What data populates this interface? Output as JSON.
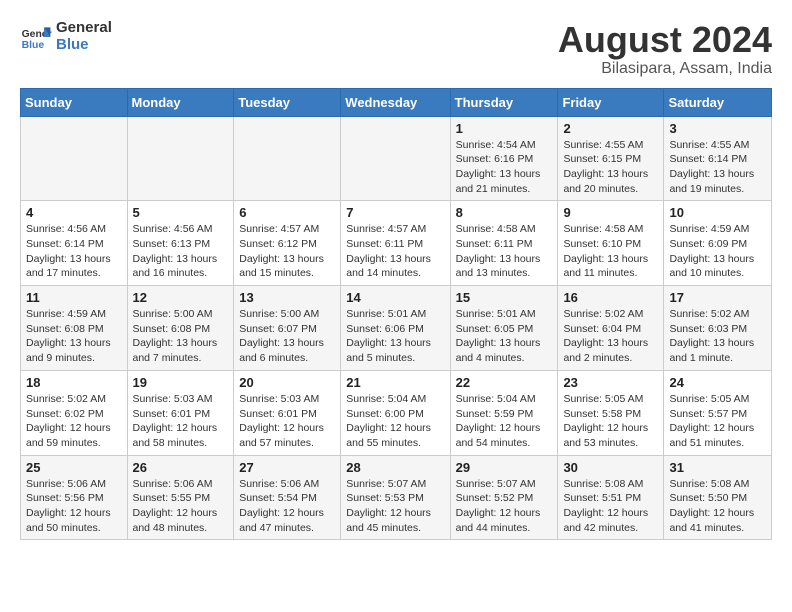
{
  "header": {
    "logo_line1": "General",
    "logo_line2": "Blue",
    "month_year": "August 2024",
    "location": "Bilasipara, Assam, India"
  },
  "weekdays": [
    "Sunday",
    "Monday",
    "Tuesday",
    "Wednesday",
    "Thursday",
    "Friday",
    "Saturday"
  ],
  "weeks": [
    [
      {
        "day": "",
        "info": ""
      },
      {
        "day": "",
        "info": ""
      },
      {
        "day": "",
        "info": ""
      },
      {
        "day": "",
        "info": ""
      },
      {
        "day": "1",
        "info": "Sunrise: 4:54 AM\nSunset: 6:16 PM\nDaylight: 13 hours\nand 21 minutes."
      },
      {
        "day": "2",
        "info": "Sunrise: 4:55 AM\nSunset: 6:15 PM\nDaylight: 13 hours\nand 20 minutes."
      },
      {
        "day": "3",
        "info": "Sunrise: 4:55 AM\nSunset: 6:14 PM\nDaylight: 13 hours\nand 19 minutes."
      }
    ],
    [
      {
        "day": "4",
        "info": "Sunrise: 4:56 AM\nSunset: 6:14 PM\nDaylight: 13 hours\nand 17 minutes."
      },
      {
        "day": "5",
        "info": "Sunrise: 4:56 AM\nSunset: 6:13 PM\nDaylight: 13 hours\nand 16 minutes."
      },
      {
        "day": "6",
        "info": "Sunrise: 4:57 AM\nSunset: 6:12 PM\nDaylight: 13 hours\nand 15 minutes."
      },
      {
        "day": "7",
        "info": "Sunrise: 4:57 AM\nSunset: 6:11 PM\nDaylight: 13 hours\nand 14 minutes."
      },
      {
        "day": "8",
        "info": "Sunrise: 4:58 AM\nSunset: 6:11 PM\nDaylight: 13 hours\nand 13 minutes."
      },
      {
        "day": "9",
        "info": "Sunrise: 4:58 AM\nSunset: 6:10 PM\nDaylight: 13 hours\nand 11 minutes."
      },
      {
        "day": "10",
        "info": "Sunrise: 4:59 AM\nSunset: 6:09 PM\nDaylight: 13 hours\nand 10 minutes."
      }
    ],
    [
      {
        "day": "11",
        "info": "Sunrise: 4:59 AM\nSunset: 6:08 PM\nDaylight: 13 hours\nand 9 minutes."
      },
      {
        "day": "12",
        "info": "Sunrise: 5:00 AM\nSunset: 6:08 PM\nDaylight: 13 hours\nand 7 minutes."
      },
      {
        "day": "13",
        "info": "Sunrise: 5:00 AM\nSunset: 6:07 PM\nDaylight: 13 hours\nand 6 minutes."
      },
      {
        "day": "14",
        "info": "Sunrise: 5:01 AM\nSunset: 6:06 PM\nDaylight: 13 hours\nand 5 minutes."
      },
      {
        "day": "15",
        "info": "Sunrise: 5:01 AM\nSunset: 6:05 PM\nDaylight: 13 hours\nand 4 minutes."
      },
      {
        "day": "16",
        "info": "Sunrise: 5:02 AM\nSunset: 6:04 PM\nDaylight: 13 hours\nand 2 minutes."
      },
      {
        "day": "17",
        "info": "Sunrise: 5:02 AM\nSunset: 6:03 PM\nDaylight: 13 hours\nand 1 minute."
      }
    ],
    [
      {
        "day": "18",
        "info": "Sunrise: 5:02 AM\nSunset: 6:02 PM\nDaylight: 12 hours\nand 59 minutes."
      },
      {
        "day": "19",
        "info": "Sunrise: 5:03 AM\nSunset: 6:01 PM\nDaylight: 12 hours\nand 58 minutes."
      },
      {
        "day": "20",
        "info": "Sunrise: 5:03 AM\nSunset: 6:01 PM\nDaylight: 12 hours\nand 57 minutes."
      },
      {
        "day": "21",
        "info": "Sunrise: 5:04 AM\nSunset: 6:00 PM\nDaylight: 12 hours\nand 55 minutes."
      },
      {
        "day": "22",
        "info": "Sunrise: 5:04 AM\nSunset: 5:59 PM\nDaylight: 12 hours\nand 54 minutes."
      },
      {
        "day": "23",
        "info": "Sunrise: 5:05 AM\nSunset: 5:58 PM\nDaylight: 12 hours\nand 53 minutes."
      },
      {
        "day": "24",
        "info": "Sunrise: 5:05 AM\nSunset: 5:57 PM\nDaylight: 12 hours\nand 51 minutes."
      }
    ],
    [
      {
        "day": "25",
        "info": "Sunrise: 5:06 AM\nSunset: 5:56 PM\nDaylight: 12 hours\nand 50 minutes."
      },
      {
        "day": "26",
        "info": "Sunrise: 5:06 AM\nSunset: 5:55 PM\nDaylight: 12 hours\nand 48 minutes."
      },
      {
        "day": "27",
        "info": "Sunrise: 5:06 AM\nSunset: 5:54 PM\nDaylight: 12 hours\nand 47 minutes."
      },
      {
        "day": "28",
        "info": "Sunrise: 5:07 AM\nSunset: 5:53 PM\nDaylight: 12 hours\nand 45 minutes."
      },
      {
        "day": "29",
        "info": "Sunrise: 5:07 AM\nSunset: 5:52 PM\nDaylight: 12 hours\nand 44 minutes."
      },
      {
        "day": "30",
        "info": "Sunrise: 5:08 AM\nSunset: 5:51 PM\nDaylight: 12 hours\nand 42 minutes."
      },
      {
        "day": "31",
        "info": "Sunrise: 5:08 AM\nSunset: 5:50 PM\nDaylight: 12 hours\nand 41 minutes."
      }
    ]
  ]
}
